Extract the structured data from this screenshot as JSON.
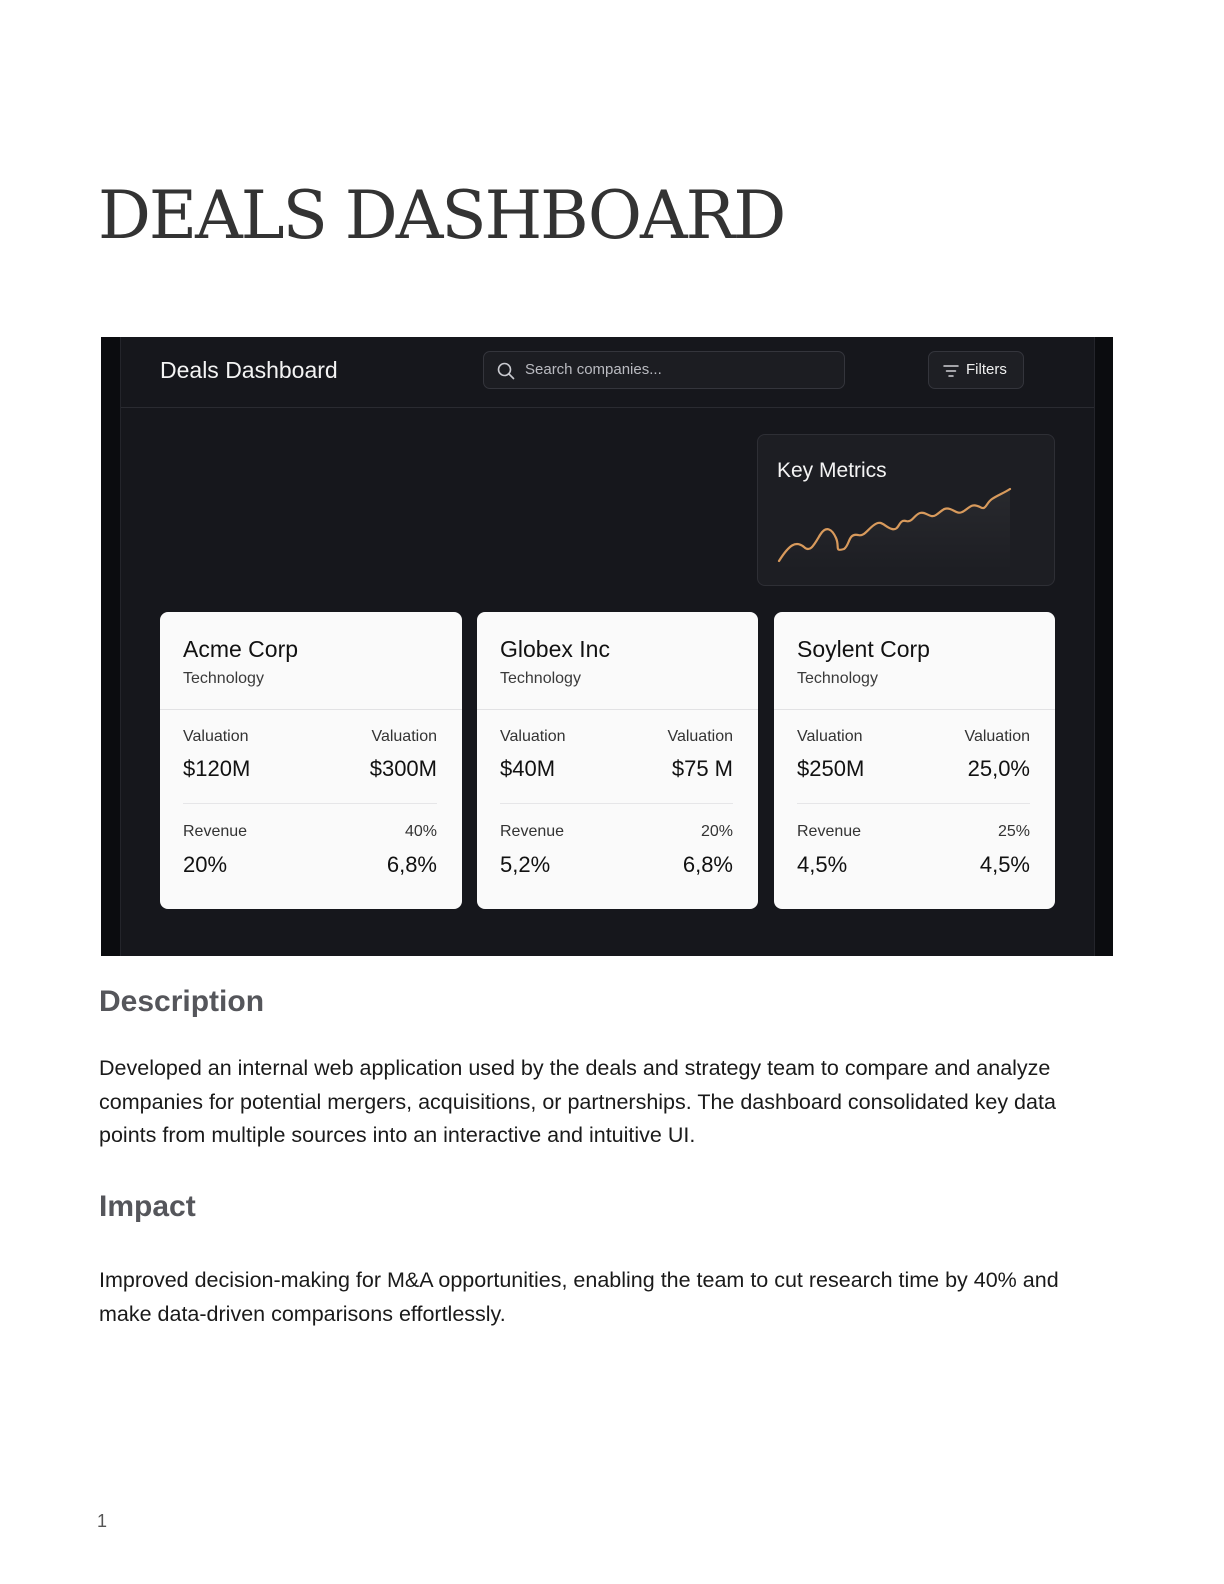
{
  "document": {
    "title": "DEALS DASHBOARD",
    "description_heading": "Description",
    "description_text": "Developed an internal web application used by the deals and strategy team to compare and analyze companies for potential mergers, acquisitions, or partnerships. The dashboard consolidated key data points from multiple sources into an interactive and intuitive UI.",
    "impact_heading": "Impact",
    "impact_text": "Improved decision-making for M&A opportunities, enabling the team to cut research time by 40% and make data-driven comparisons effortlessly.",
    "page_number": "1"
  },
  "app": {
    "title": "Deals Dashboard",
    "search_placeholder": "Search companies...",
    "filters_label": "Filters",
    "accent_color": "#d89a5c",
    "metrics": {
      "title": "Key Metrics"
    },
    "cards": [
      {
        "name": "Acme Corp",
        "sector": "Technology",
        "row1": {
          "left_label": "Valuation",
          "left_value": "$120M",
          "right_label": "Valuation",
          "right_value": "$300M"
        },
        "row2": {
          "left_label": "Revenue",
          "left_value": "20%",
          "right_label": "40%",
          "right_value": "6,8%"
        }
      },
      {
        "name": "Globex Inc",
        "sector": "Technology",
        "row1": {
          "left_label": "Valuation",
          "left_value": "$40M",
          "right_label": "Valuation",
          "right_value": "$75 M"
        },
        "row2": {
          "left_label": "Revenue",
          "left_value": "5,2%",
          "right_label": "20%",
          "right_value": "6,8%"
        }
      },
      {
        "name": "Soylent Corp",
        "sector": "Technology",
        "row1": {
          "left_label": "Valuation",
          "left_value": "$250M",
          "right_label": "Valuation",
          "right_value": "25,0%"
        },
        "row2": {
          "left_label": "Revenue",
          "left_value": "4,5%",
          "right_label": "25%",
          "right_value": "4,5%"
        }
      }
    ]
  }
}
